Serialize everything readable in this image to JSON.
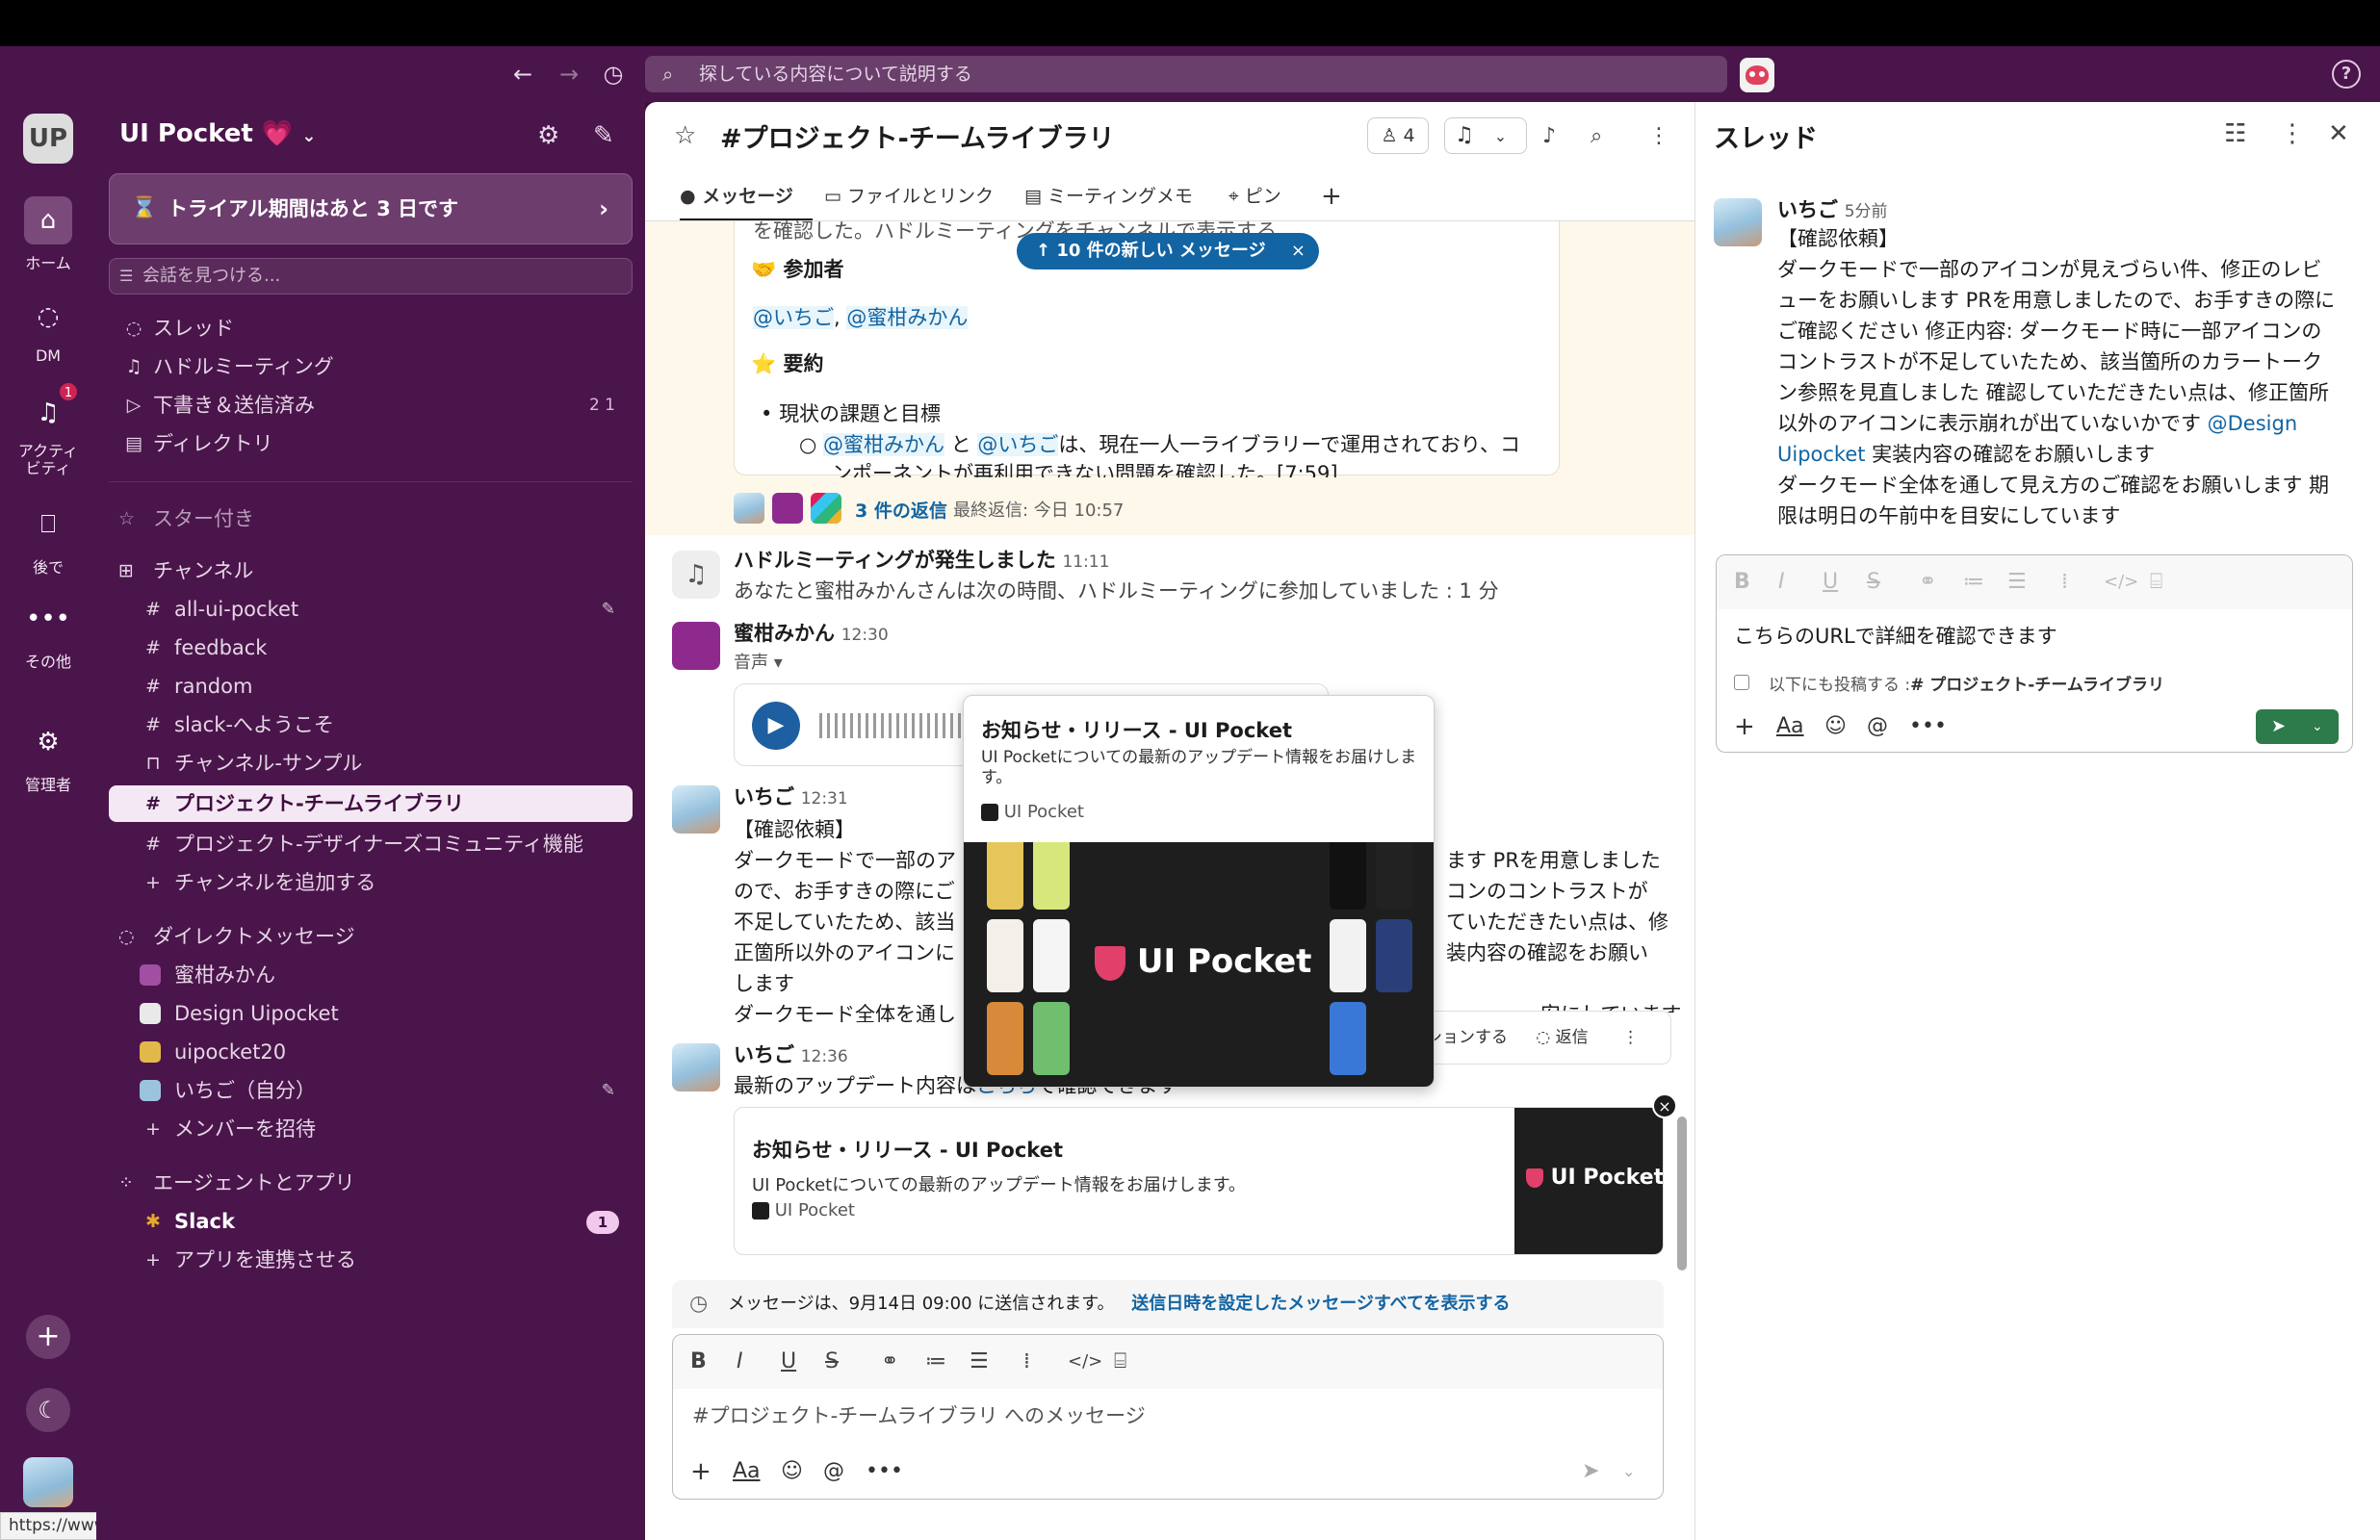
{
  "titlebar": {
    "search_placeholder": "探している内容について説明する",
    "status_url": "https://www.ui-pocket.com/news"
  },
  "rail": {
    "workspace_initials": "UP",
    "home": "ホーム",
    "dm": "DM",
    "activity": "アクティビティ",
    "activity_badge": "1",
    "later": "後で",
    "more": "その他",
    "admin": "管理者"
  },
  "sidebar": {
    "workspace_name": "UI Pocket 💗",
    "trial": "トライアル期間はあと 3 日です",
    "find_placeholder": "会話を見つける...",
    "threads": "スレッド",
    "huddles": "ハドルミーティング",
    "drafts": "下書き＆送信済み",
    "drafts_counts": "2 1",
    "directory": "ディレクトリ",
    "starred": "スター付き",
    "channels_header": "チャンネル",
    "channels": [
      "all-ui-pocket",
      "feedback",
      "random",
      "slack-へようこそ",
      "チャンネル-サンプル",
      "プロジェクト-チームライブラリ",
      "プロジェクト-デザイナーズコミュニティ機能"
    ],
    "add_channel": "チャンネルを追加する",
    "dm_header": "ダイレクトメッセージ",
    "dms": [
      "蜜柑みかん",
      "Design Uipocket",
      "uipocket20",
      "いちご（自分）"
    ],
    "invite": "メンバーを招待",
    "apps_header": "エージェントとアプリ",
    "slack": "Slack",
    "slack_badge": "1",
    "connect_app": "アプリを連携させる"
  },
  "channel": {
    "title": "#プロジェクト-チームライブラリ",
    "members": "4",
    "tabs": [
      "メッセージ",
      "ファイルとリンク",
      "ミーティングメモ",
      "ピン"
    ],
    "new_messages": "↑ 10 件の新しい メッセージ"
  },
  "messages": {
    "cut_top": "を確認した。ハドルミーティングをチャンネルで表示する",
    "participants_heading": "🤝 参加者",
    "participant_1": "@いちご",
    "participant_sep": ", ",
    "participant_2": "@蜜柑みかん",
    "summary_heading": "⭐ 要約",
    "bullet1": "現状の課題と目標",
    "sub1_m1": "@蜜柑みかん",
    "sub1_and": " と ",
    "sub1_m2": "@いちご",
    "sub1_rest": "は、現在一人一ライブラリーで運用されており、コ",
    "sub1_line2": "ンポーネントが再利用できない問題を確認した。[7:59]",
    "replies": "3 件の返信",
    "last_reply": "最終返信: 今日 10:57",
    "huddle_title": "ハドルミーティングが発生しました",
    "huddle_time": "11:11",
    "huddle_desc": "あなたと蜜柑みかんさんは次の時間、ハドルミーティングに参加していました : 1 分",
    "m2_name": "蜜柑みかん",
    "m2_time": "12:30",
    "m2_voice": "音声 ▾",
    "m3_name": "いちご",
    "m3_time": "12:31",
    "m3_l1": "【確認依頼】",
    "m3_l2": "ダークモードで一部のア",
    "m3_l2b": "ます PRを用意しました",
    "m3_l3": "ので、お手すきの際にご",
    "m3_l3b": "コンのコントラストが",
    "m3_l4": "不足していたため、該当",
    "m3_l4b": "ていただきたい点は、修",
    "m3_l5": "正箇所以外のアイコンに",
    "m3_l5b": "装内容の確認をお願い",
    "m3_l6": "します",
    "m3_l7": "ダークモード全体を通し",
    "m3_l7b": "安にしています",
    "hover_react": "ションする",
    "hover_reply": "返信",
    "m4_name": "いちご",
    "m4_time": "12:36",
    "m4_text": "最新のアップデート内容は",
    "m4_link": "こちら",
    "m4_tail": "で確認できます"
  },
  "popup": {
    "title": "お知らせ・リリース - UI Pocket",
    "desc": "UI Pocketについての最新のアップデート情報をお届けします。",
    "site": "UI Pocket",
    "brand": "UI Pocket"
  },
  "linkcard": {
    "title": "お知らせ・リリース - UI Pocket",
    "desc": "UI Pocketについての最新のアップデート情報をお届けします。",
    "site": "UI Pocket",
    "brand": "UI Pocket"
  },
  "composer": {
    "schedule_text": "メッセージは、9月14日 09:00 に送信されます。",
    "schedule_link": "送信日時を設定したメッセージすべてを表示する",
    "placeholder": "#プロジェクト-チームライブラリ へのメッセージ"
  },
  "thread": {
    "title": "スレッド",
    "name": "いちご",
    "time": "5分前",
    "l1": "【確認依頼】",
    "l2": "ダークモードで一部のアイコンが見えづらい件、修正のレビ",
    "l3": "ューをお願いします PRを用意しましたので、お手すきの際に",
    "l4": "ご確認ください 修正内容: ダークモード時に一部アイコンの",
    "l5": "コントラストが不足していたため、該当箇所のカラートーク",
    "l6": "ン参照を見直しました 確認していただきたい点は、修正箇所",
    "l7": "以外のアイコンに表示崩れが出ていないかです ",
    "l7_mention": "@Design",
    "l8_mention": "Uipocket",
    "l8": " 実装内容の確認をお願いします",
    "l9": "ダークモード全体を通して見え方のご確認をお願いします 期",
    "l10": "限は明日の午前中を目安にしています",
    "reply_text": "こちらのURLで詳細を確認できます",
    "also_post_prefix": "以下にも投稿する :",
    "also_post_channel": "# プロジェクト-チームライブラリ"
  }
}
